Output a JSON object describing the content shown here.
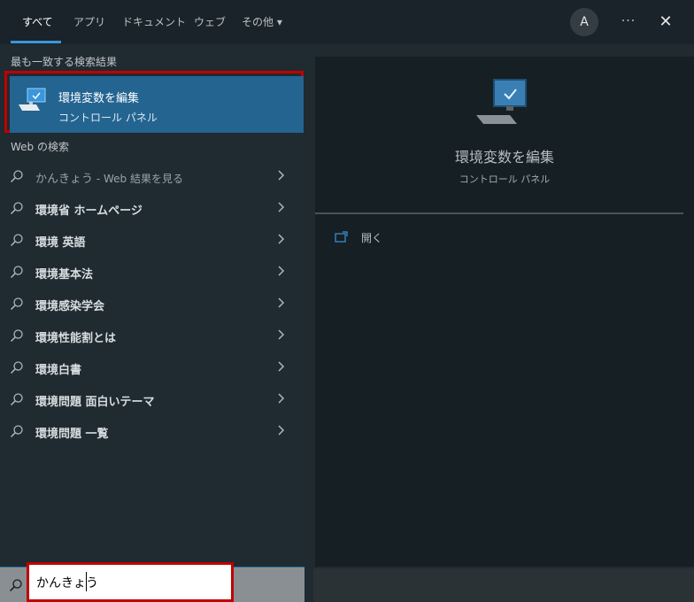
{
  "tabs": [
    {
      "label": "すべて",
      "active": true
    },
    {
      "label": "アプリ"
    },
    {
      "label": "ドキュメント"
    },
    {
      "label": "ウェブ"
    },
    {
      "label": "その他 ▾"
    }
  ],
  "header": {
    "avatar": "A",
    "more": "···",
    "close": "✕"
  },
  "best_match": {
    "section_label": "最も一致する検索結果",
    "title": "環境変数を編集",
    "subtitle": "コントロール パネル",
    "icon": "monitor-check-icon"
  },
  "web": {
    "section_label": "Web の検索",
    "items": [
      {
        "label": "かんきょう",
        "suffix": " - Web 結果を見る"
      },
      {
        "label": "環境省 ホームページ"
      },
      {
        "label": "環境 英語"
      },
      {
        "label": "環境基本法"
      },
      {
        "label": "環境感染学会"
      },
      {
        "label": "環境性能割とは"
      },
      {
        "label": "環境白書"
      },
      {
        "label": "環境問題 面白いテーマ"
      },
      {
        "label": "環境問題 一覧"
      }
    ]
  },
  "preview": {
    "title": "環境変数を編集",
    "subtitle": "コントロール パネル",
    "action_open": "開く",
    "icon": "monitor-check-icon"
  },
  "search": {
    "value": "かんきょう"
  },
  "colors": {
    "accent": "#3a96dd",
    "highlight": "#236491",
    "annotation": "#c00000"
  }
}
